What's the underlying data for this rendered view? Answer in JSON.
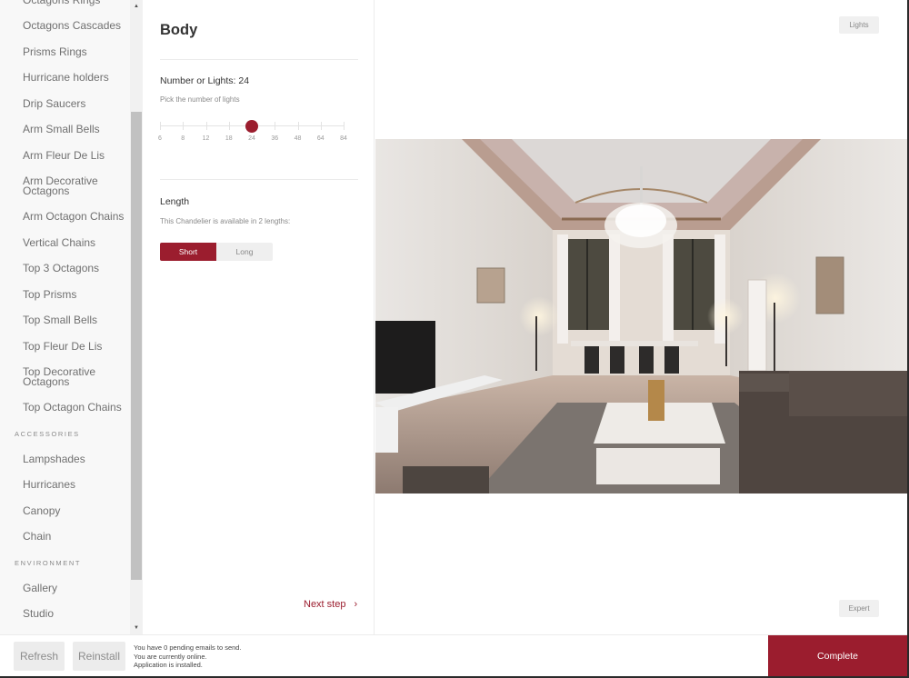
{
  "sidebar": {
    "items": [
      {
        "type": "item",
        "label": "Octagons Rings"
      },
      {
        "type": "item",
        "label": "Octagons Cascades"
      },
      {
        "type": "item",
        "label": "Prisms Rings"
      },
      {
        "type": "item",
        "label": "Hurricane holders"
      },
      {
        "type": "item",
        "label": "Drip Saucers"
      },
      {
        "type": "item",
        "label": "Arm Small Bells"
      },
      {
        "type": "item",
        "label": "Arm Fleur De Lis"
      },
      {
        "type": "item",
        "label": "Arm Decorative Octagons",
        "tall": true
      },
      {
        "type": "item",
        "label": "Arm Octagon Chains"
      },
      {
        "type": "item",
        "label": "Vertical Chains"
      },
      {
        "type": "item",
        "label": "Top 3 Octagons"
      },
      {
        "type": "item",
        "label": "Top Prisms"
      },
      {
        "type": "item",
        "label": "Top Small Bells"
      },
      {
        "type": "item",
        "label": "Top Fleur De Lis"
      },
      {
        "type": "item",
        "label": "Top Decorative Octagons",
        "tall": true
      },
      {
        "type": "item",
        "label": "Top Octagon Chains"
      },
      {
        "type": "header",
        "label": "ACCESSORIES"
      },
      {
        "type": "item",
        "label": "Lampshades"
      },
      {
        "type": "item",
        "label": "Hurricanes"
      },
      {
        "type": "item",
        "label": "Canopy"
      },
      {
        "type": "item",
        "label": "Chain"
      },
      {
        "type": "header",
        "label": "ENVIRONMENT"
      },
      {
        "type": "item",
        "label": "Gallery"
      },
      {
        "type": "item",
        "label": "Studio"
      }
    ],
    "scroll_up_icon": "▲",
    "scroll_down_icon": "▼"
  },
  "config": {
    "title": "Body",
    "lights": {
      "label": "Number or Lights: 24",
      "hint": "Pick the number of lights",
      "options": [
        "6",
        "8",
        "12",
        "18",
        "24",
        "36",
        "48",
        "64",
        "84"
      ],
      "selected_index": 4,
      "selected_value": 24
    },
    "length": {
      "label": "Length",
      "hint": "This Chandelier is available in 2 lengths:",
      "options": [
        "Short",
        "Long"
      ],
      "selected": "Short"
    },
    "next_step_label": "Next step",
    "next_step_icon": "›"
  },
  "preview": {
    "lights_button": "Lights",
    "expert_button": "Expert",
    "image_alt": "Living room interior with crystal chandelier under frescoed ceiling"
  },
  "footer": {
    "refresh_label": "Refresh",
    "reinstall_label": "Reinstall",
    "status_lines": [
      "You have 0 pending emails to send.",
      "You are currently online.",
      "Application is installed."
    ],
    "complete_label": "Complete"
  },
  "colors": {
    "accent": "#9b1d2e"
  }
}
